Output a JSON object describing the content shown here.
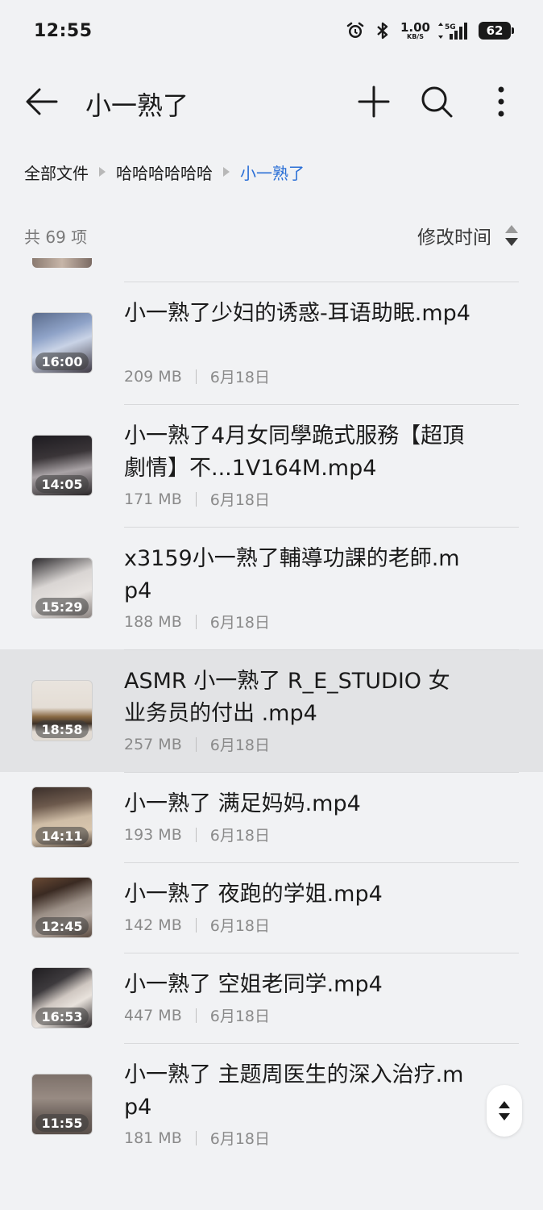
{
  "status_bar": {
    "time": "12:55",
    "net_speed_value": "1.00",
    "net_speed_unit": "KB/S",
    "network_type": "5G",
    "battery": "62"
  },
  "header": {
    "title": "小一熟了",
    "icons": [
      "arrow-left-icon",
      "plus-icon",
      "search-icon",
      "more-vertical-icon"
    ]
  },
  "breadcrumb": {
    "items": [
      "全部文件",
      "哈哈哈哈哈哈",
      "小一熟了"
    ]
  },
  "list_meta": {
    "count": "共 69 项",
    "sort_label": "修改时间"
  },
  "files": [
    {
      "name": "小一熟了少妇的诱惑-耳语助眠.mp4",
      "size": "209 MB",
      "date": "6月18日",
      "duration": "16:00",
      "selected": false
    },
    {
      "name": "小一熟了4月女同學跪式服務【超頂劇情】不...1V164M.mp4",
      "size": "171 MB",
      "date": "6月18日",
      "duration": "14:05",
      "selected": false
    },
    {
      "name": "x3159小一熟了輔導功課的老師.mp4",
      "size": "188 MB",
      "date": "6月18日",
      "duration": "15:29",
      "selected": false
    },
    {
      "name": "ASMR  小一熟了  R_E_STUDIO 女业务员的付出 .mp4",
      "size": "257 MB",
      "date": "6月18日",
      "duration": "18:58",
      "selected": true
    },
    {
      "name": "小一熟了 满足妈妈.mp4",
      "size": "193 MB",
      "date": "6月18日",
      "duration": "14:11",
      "selected": false
    },
    {
      "name": "小一熟了 夜跑的学姐.mp4",
      "size": "142 MB",
      "date": "6月18日",
      "duration": "12:45",
      "selected": false
    },
    {
      "name": "小一熟了 空姐老同学.mp4",
      "size": "447 MB",
      "date": "6月18日",
      "duration": "16:53",
      "selected": false
    },
    {
      "name": "小一熟了 主题周医生的深入治疗.mp4",
      "size": "181 MB",
      "date": "6月18日",
      "duration": "11:55",
      "selected": false
    }
  ],
  "colors": {
    "background": "#f1f2f4",
    "accent": "#2a6fd6",
    "selected_row": "#e2e3e5"
  }
}
